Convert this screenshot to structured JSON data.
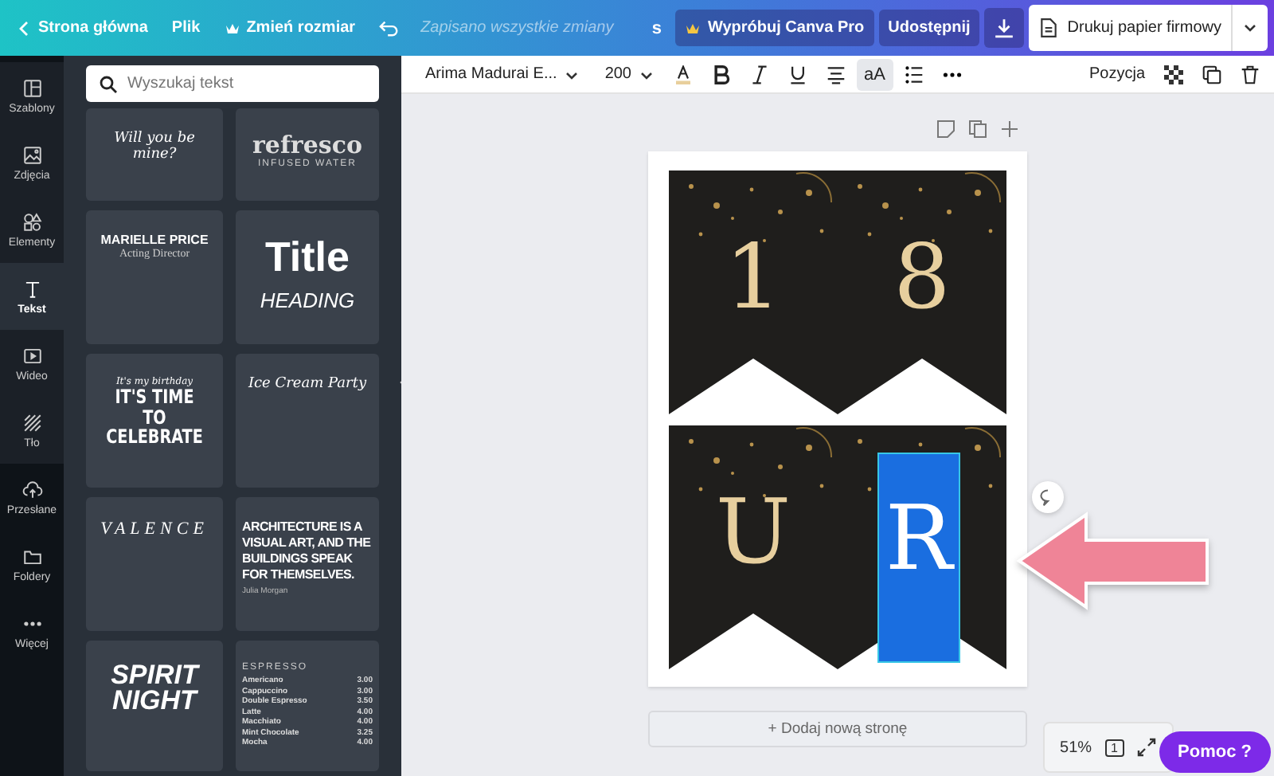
{
  "top_bar": {
    "home": "Strona główna",
    "file": "Plik",
    "resize": "Zmień rozmiar",
    "save_status": "Zapisano wszystkie zmiany",
    "badge": "s",
    "try_pro": "Wypróbuj Canva Pro",
    "share": "Udostępnij",
    "print": "Drukuj papier firmowy"
  },
  "sidebar": {
    "items": [
      {
        "label": "Szablony",
        "selected": false
      },
      {
        "label": "Zdjęcia",
        "selected": false
      },
      {
        "label": "Elementy",
        "selected": false
      },
      {
        "label": "Tekst",
        "selected": true
      },
      {
        "label": "Wideo",
        "selected": false
      },
      {
        "label": "Tło",
        "selected": false
      },
      {
        "label": "Przesłane",
        "selected": false
      },
      {
        "label": "Foldery",
        "selected": false
      },
      {
        "label": "Więcej",
        "selected": false
      }
    ]
  },
  "panel": {
    "search": {
      "placeholder": "Wyszukaj tekst"
    },
    "templates": [
      [
        {
          "kind": "script",
          "text": "Will you be mine?"
        }
      ],
      [
        {
          "kind": "serif-big",
          "text": "refresco"
        },
        {
          "kind": "caps-small",
          "text": "INFUSED WATER"
        }
      ],
      [
        {
          "kind": "sans-bold",
          "text": "MARIELLE PRICE"
        },
        {
          "kind": "serif-small",
          "text": "Acting Director"
        }
      ],
      [
        {
          "kind": "title",
          "text": "Title"
        },
        {
          "kind": "italic-caps",
          "text": "HEADING"
        }
      ],
      [
        {
          "kind": "script-small",
          "text": "It's my birthday"
        },
        {
          "kind": "condensed",
          "text": "IT'S TIME TO CELEBRATE"
        }
      ],
      [
        {
          "kind": "script",
          "text": "Ice Cream Party"
        }
      ],
      [
        {
          "kind": "spaced-serif",
          "text": "VALENCE"
        }
      ],
      [
        {
          "kind": "condensed-left",
          "text": "ARCHITECTURE IS A VISUAL ART, AND THE BUILDINGS SPEAK FOR THEMSELVES."
        },
        {
          "kind": "tiny-left",
          "text": "Julia Morgan"
        }
      ],
      [
        {
          "kind": "brush",
          "text": "SPIRIT NIGHT"
        }
      ],
      [
        {
          "kind": "menu-title",
          "text": "ESPRESSO"
        },
        {
          "kind": "menu-row",
          "text": "Americano",
          "price": "3.00"
        },
        {
          "kind": "menu-row",
          "text": "Cappuccino",
          "price": "3.00"
        },
        {
          "kind": "menu-row",
          "text": "Double Espresso",
          "price": "3.50"
        },
        {
          "kind": "menu-row",
          "text": "Latte",
          "price": "4.00"
        },
        {
          "kind": "menu-row",
          "text": "Macchiato",
          "price": "4.00"
        },
        {
          "kind": "menu-row",
          "text": "Mint Chocolate",
          "price": "3.25"
        },
        {
          "kind": "menu-row",
          "text": "Mocha",
          "price": "4.00"
        }
      ]
    ]
  },
  "toolbar": {
    "font": "Arima Madurai E...",
    "size": "200",
    "case_toggle": "aA",
    "position": "Pozycja"
  },
  "pennants": [
    {
      "letter": "1",
      "selected": false
    },
    {
      "letter": "8",
      "selected": false
    },
    {
      "letter": "U",
      "selected": false
    },
    {
      "letter": "R",
      "selected": true
    }
  ],
  "add_page": "+ Dodaj nową stronę",
  "zoom": {
    "value": "51%",
    "page": "1"
  },
  "help": "Pomoc ?"
}
